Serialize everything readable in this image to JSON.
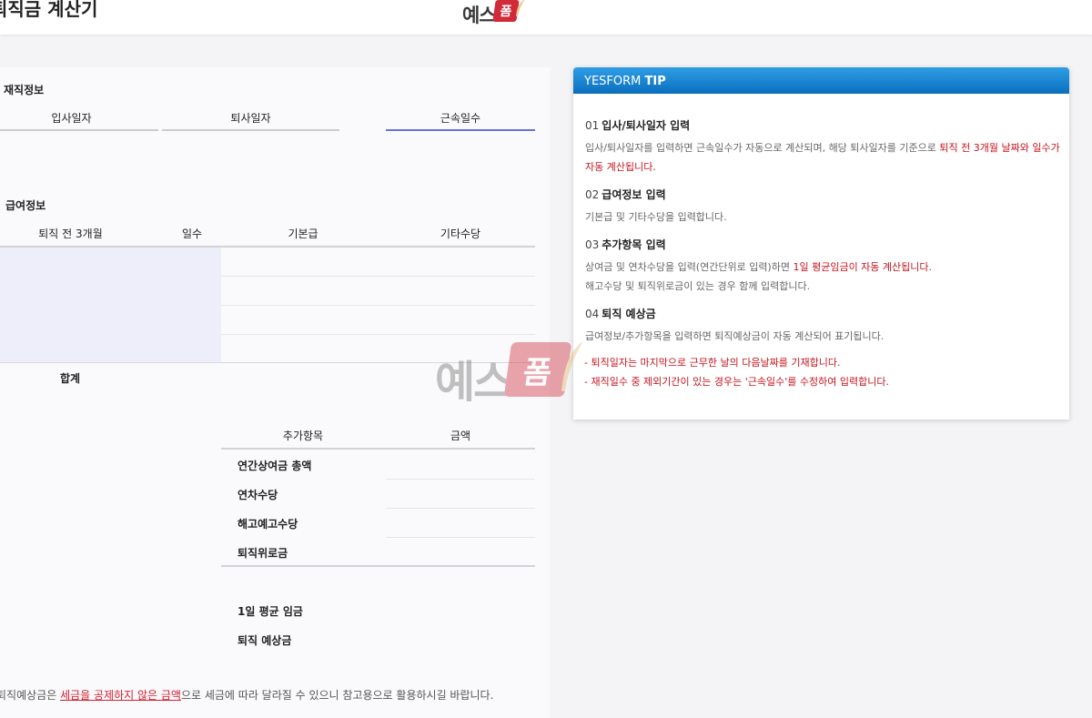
{
  "header": {
    "page_title": "퇴직금 계산기",
    "logo_text": "예스",
    "logo_badge": "폼"
  },
  "employment": {
    "section_title": "재직정보",
    "columns": [
      "입사일자",
      "퇴사일자",
      "근속일수"
    ]
  },
  "salary": {
    "section_title": "급여정보",
    "columns": [
      "퇴직 전 3개월",
      "일수",
      "기본급",
      "기타수당"
    ],
    "total_label": "합계"
  },
  "extra": {
    "columns": [
      "추가항목",
      "금액"
    ],
    "rows": [
      "연간상여금 총액",
      "연차수당",
      "해고예고수당",
      "퇴직위로금"
    ]
  },
  "results": {
    "daily_wage_label": "1일 평균 임금",
    "severance_label": "퇴직 예상금"
  },
  "footnote": {
    "prefix": "퇴직예상금은 ",
    "warn": "세금을 공제하지 않은 금액",
    "suffix": "으로 세금에 따라 달라질 수 있으니 참고용으로 활용하시길 바랍니다."
  },
  "tip": {
    "header_light": "YESFORM ",
    "header_bold": "TIP",
    "items": [
      {
        "num": "01",
        "title": "입사/퇴사일자 입력",
        "body_plain": "입사/퇴사일자를 입력하면 근속일수가 자동으로 계산되며, 해당 퇴사일자를 기준으로 ",
        "body_hl": "퇴직 전 3개월 날짜와 일수가 자동 계산됩니다.",
        "body_plain2": "",
        "body_line2": ""
      },
      {
        "num": "02",
        "title": "급여정보 입력",
        "body_plain": "기본급 및 기타수당을 입력합니다.",
        "body_hl": "",
        "body_plain2": "",
        "body_line2": ""
      },
      {
        "num": "03",
        "title": "추가항목 입력",
        "body_plain": "상여금 및 연차수당을 입력(연간단위로 입력)하면 ",
        "body_hl": "1일 평균임금이 자동 계산됩니다.",
        "body_plain2": "",
        "body_line2": "해고수당 및 퇴직위로금이 있는 경우 함께 입력합니다."
      },
      {
        "num": "04",
        "title": "퇴직 예상금",
        "body_plain": "급여정보/추가항목을 입력하면 퇴직예상금이 자동 계산되어 표기됩니다.",
        "body_hl": "",
        "body_plain2": "",
        "body_line2": ""
      }
    ],
    "notes": [
      "- 퇴직일자는 마지막으로 근무한 날의 다음날짜를 기재합니다.",
      "- 재직일수 중 제외기간이 있는 경우는 '근속일수'를 수정하여 입력합니다."
    ]
  },
  "watermark": {
    "text": "예스",
    "badge": "폼"
  },
  "colors": {
    "accent": "#6b72d8",
    "warn": "#c4141e",
    "tip_header": "#0a6fbd",
    "shade": "#eeeefb"
  }
}
